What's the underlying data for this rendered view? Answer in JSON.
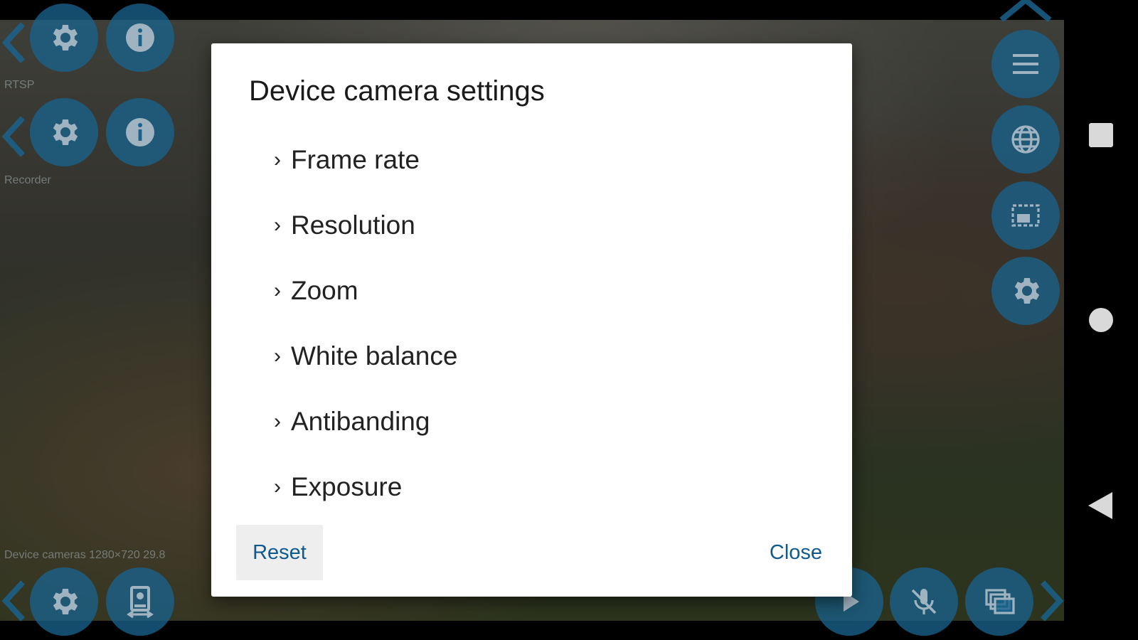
{
  "overlay": {
    "rtsp_label": "RTSP",
    "recorder_label": "Recorder",
    "device_label": "Device cameras 1280×720  29.8"
  },
  "left_buttons": [
    {
      "name": "rtsp-settings",
      "icon": "gear-icon"
    },
    {
      "name": "rtsp-info",
      "icon": "info-icon"
    },
    {
      "name": "recorder-settings",
      "icon": "gear-icon"
    },
    {
      "name": "recorder-info",
      "icon": "info-icon"
    },
    {
      "name": "device-settings",
      "icon": "gear-icon"
    },
    {
      "name": "device-camera-switch",
      "icon": "camera-switch-icon"
    }
  ],
  "right_buttons": [
    {
      "name": "menu",
      "icon": "menu-icon"
    },
    {
      "name": "web",
      "icon": "globe-icon"
    },
    {
      "name": "picture-in-picture",
      "icon": "pip-icon"
    },
    {
      "name": "settings",
      "icon": "gear-icon"
    }
  ],
  "bottom_buttons": [
    {
      "name": "play",
      "icon": "play-icon"
    },
    {
      "name": "mute",
      "icon": "mic-off-icon"
    },
    {
      "name": "windows",
      "icon": "layers-icon"
    }
  ],
  "dialog": {
    "title": "Device camera settings",
    "options": [
      "Frame rate",
      "Resolution",
      "Zoom",
      "White balance",
      "Antibanding",
      "Exposure"
    ],
    "chevron": "›",
    "reset_label": "Reset",
    "close_label": "Close"
  },
  "colors": {
    "accent": "#0e5a8f",
    "fab": "#1a628c"
  }
}
